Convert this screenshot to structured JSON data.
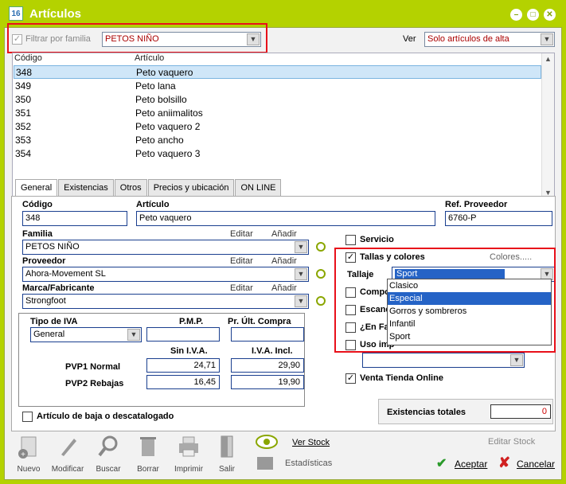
{
  "window": {
    "title": "Artículos"
  },
  "filter": {
    "label": "Filtrar por familia",
    "value": "PETOS NIÑO",
    "ver_label": "Ver",
    "ver_value": "Solo artículos de alta"
  },
  "list": {
    "headers": [
      "Código",
      "Artículo"
    ],
    "rows": [
      {
        "code": "348",
        "name": "Peto vaquero"
      },
      {
        "code": "349",
        "name": "Peto lana"
      },
      {
        "code": "350",
        "name": "Peto bolsillo"
      },
      {
        "code": "351",
        "name": "Peto aniimalitos"
      },
      {
        "code": "352",
        "name": "Peto vaquero 2"
      },
      {
        "code": "353",
        "name": "Peto ancho"
      },
      {
        "code": "354",
        "name": "Peto vaquero 3"
      }
    ]
  },
  "tabs": [
    "General",
    "Existencias",
    "Otros",
    "Precios y ubicación",
    "ON LINE"
  ],
  "general": {
    "codigo_label": "Código",
    "codigo": "348",
    "articulo_label": "Artículo",
    "articulo": "Peto vaquero",
    "ref_label": "Ref. Proveedor",
    "ref": "6760-P",
    "familia_label": "Familia",
    "familia": "PETOS NIÑO",
    "proveedor_label": "Proveedor",
    "proveedor": "Ahora-Movement SL",
    "marca_label": "Marca/Fabricante",
    "marca": "Strongfoot",
    "editar": "Editar",
    "anadir": "Añadir",
    "tipo_iva_label": "Tipo de IVA",
    "tipo_iva": "General",
    "pmp_label": "P.M.P.",
    "pr_ult_label": "Pr. Últ. Compra",
    "sin_iva_label": "Sin I.V.A.",
    "con_iva_label": "I.V.A. Incl.",
    "pvp1_label": "PVP1 Normal",
    "pvp1_sin": "24,71",
    "pvp1_con": "29,90",
    "pvp2_label": "PVP2 Rebajas",
    "pvp2_sin": "16,45",
    "pvp2_con": "19,90",
    "baja_label": "Artículo de baja o descatalogado",
    "servicio": "Servicio",
    "tallas": "Tallas y colores",
    "colores": "Colores.....",
    "tallaje_label": "Tallaje",
    "tallaje": "Sport",
    "tallaje_options": [
      "Clasico",
      "Especial",
      "Gorros y sombreros",
      "Infantil",
      "Sport"
    ],
    "compo": "Compo",
    "escanda": "Escanda",
    "en_fav": "¿En Fav",
    "uso_imp": "Uso imp",
    "venta_online": "Venta Tienda Online",
    "existencias_label": "Existencias totales",
    "existencias": "0"
  },
  "toolbar": {
    "nuevo": "Nuevo",
    "modificar": "Modificar",
    "buscar": "Buscar",
    "borrar": "Borrar",
    "imprimir": "Imprimir",
    "salir": "Salir",
    "ver_stock": "Ver Stock",
    "estadisticas": "Estadísticas",
    "editar_stock": "Editar Stock",
    "aceptar": "Aceptar",
    "cancelar": "Cancelar"
  },
  "colors": {
    "titlebar": "#b4d200",
    "selection": "#cfe6f8",
    "highlight": "#2563c6",
    "annotation": "#e8101a"
  }
}
